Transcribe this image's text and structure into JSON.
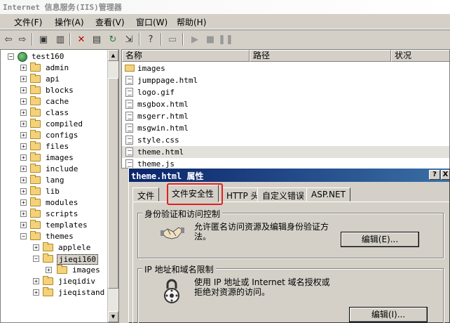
{
  "window": {
    "title": "Internet 信息服务(IIS)管理器"
  },
  "menu": [
    {
      "label": "文件(F)"
    },
    {
      "label": "操作(A)"
    },
    {
      "label": "查看(V)"
    },
    {
      "label": "窗口(W)"
    },
    {
      "label": "帮助(H)"
    }
  ],
  "toolbar": {
    "icons": [
      "back-arrow-icon",
      "forward-arrow-icon",
      "up-folder-icon",
      "show-tree-icon",
      "delete-icon",
      "properties-icon",
      "refresh-icon",
      "export-icon",
      "help-icon",
      "server-icon",
      "play-icon",
      "stop-icon",
      "pause-icon"
    ]
  },
  "tree": {
    "root": "test160",
    "items": [
      "admin",
      "api",
      "blocks",
      "cache",
      "class",
      "compiled",
      "configs",
      "files",
      "images",
      "include",
      "lang",
      "lib",
      "modules",
      "scripts",
      "templates",
      "themes"
    ],
    "children": [
      "applele",
      "jieqi160"
    ],
    "grandchild": "images",
    "after": [
      "jieqidiv",
      "jieqistand"
    ]
  },
  "list": {
    "columns": [
      "名称",
      "路径",
      "状况"
    ],
    "rows": [
      {
        "name": "images",
        "type": "folder"
      },
      {
        "name": "jumppage.html",
        "type": "file"
      },
      {
        "name": "logo.gif",
        "type": "file"
      },
      {
        "name": "msgbox.html",
        "type": "file"
      },
      {
        "name": "msgerr.html",
        "type": "file"
      },
      {
        "name": "msgwin.html",
        "type": "file"
      },
      {
        "name": "style.css",
        "type": "file"
      },
      {
        "name": "theme.html",
        "type": "file"
      },
      {
        "name": "theme.js",
        "type": "file"
      }
    ]
  },
  "dialog": {
    "title": "theme.html 属性",
    "help_btn": "?",
    "close_btn": "X",
    "tabs": [
      "文件",
      "文件安全性",
      "HTTP 头",
      "自定义错误",
      "ASP.NET"
    ],
    "auth": {
      "title": "身份验证和访问控制",
      "line1": "允许匿名访问资源及编辑身份验证方",
      "line2": "法。",
      "edit": "编辑(E)..."
    },
    "ip": {
      "title": "IP 地址和域名限制",
      "line1": "使用 IP 地址或 Internet 域名授权或",
      "line2": "拒绝对资源的访问。",
      "edit": "编辑(I)..."
    }
  }
}
